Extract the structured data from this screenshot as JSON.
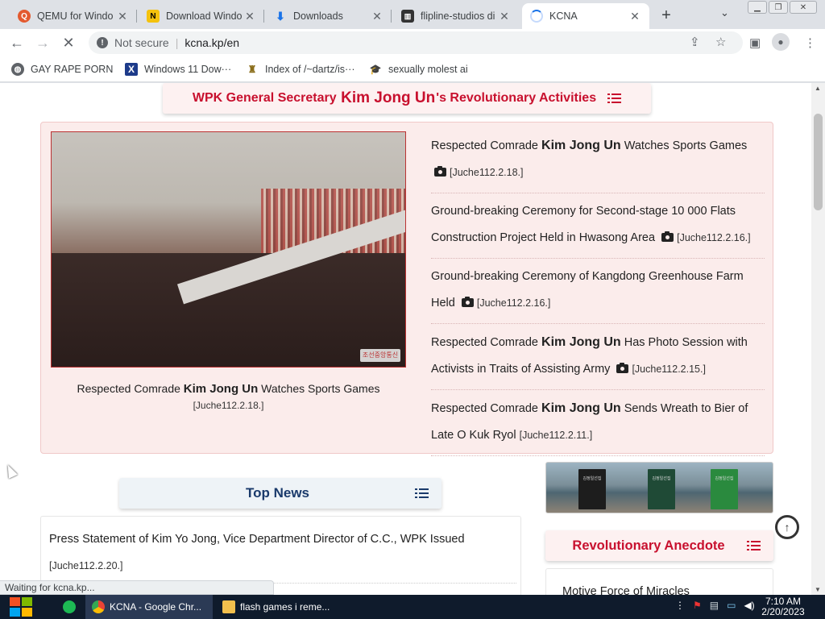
{
  "browser": {
    "tabs": [
      {
        "title": "QEMU for Windo",
        "icon": "qemu-icon",
        "active": false
      },
      {
        "title": "Download Windo",
        "icon": "download-site-icon",
        "active": false
      },
      {
        "title": "Downloads",
        "icon": "download-icon",
        "active": false
      },
      {
        "title": "flipline-studios di",
        "icon": "archive-icon",
        "active": false
      },
      {
        "title": "KCNA",
        "icon": "loading-icon",
        "active": true
      }
    ],
    "new_tab": "+",
    "address": {
      "security": "Not secure",
      "url": "kcna.kp/en"
    },
    "bookmarks": [
      {
        "label": "GAY RAPE PORN",
        "icon": "globe-icon"
      },
      {
        "label": "Windows 11 Dow···",
        "icon": "x-logo-icon"
      },
      {
        "label": "Index of /~dartz/is···",
        "icon": "folder-man-icon"
      },
      {
        "label": "sexually molest ai",
        "icon": "cap-icon"
      }
    ],
    "status": "Waiting for kcna.kp..."
  },
  "page": {
    "hero_title": {
      "prefix": "WPK General Secretary ",
      "name": "Kim Jong Un",
      "suffix": "'s Revolutionary Activities"
    },
    "hero_photo_watermark": "조선중앙통신",
    "hero_caption": {
      "prefix": "Respected Comrade ",
      "name": "Kim Jong Un",
      "suffix": " Watches Sports Games",
      "date": "[Juche112.2.18.]"
    },
    "news": [
      {
        "prefix": "Respected Comrade ",
        "name": "Kim Jong Un",
        "suffix": " Watches Sports Games",
        "photo": true,
        "date": "[Juche112.2.18.]"
      },
      {
        "prefix": "Ground-breaking Ceremony for Second-stage 10 000 Flats Construction Project Held in Hwasong Area",
        "name": "",
        "suffix": "",
        "photo": true,
        "date": "[Juche112.2.16.]"
      },
      {
        "prefix": "Ground-breaking Ceremony of Kangdong Greenhouse Farm Held",
        "name": "",
        "suffix": "",
        "photo": true,
        "date": "[Juche112.2.16.]"
      },
      {
        "prefix": "Respected Comrade ",
        "name": "Kim Jong Un",
        "suffix": " Has Photo Session with Activists in Traits of Assisting Army",
        "photo": true,
        "date": "[Juche112.2.15.]"
      },
      {
        "prefix": "Respected Comrade ",
        "name": "Kim Jong Un",
        "suffix": " Sends Wreath to Bier of Late O Kuk Ryol",
        "photo": false,
        "date": "[Juche112.2.11.]"
      }
    ],
    "top_news": {
      "title": "Top News",
      "items": [
        {
          "text": "Press Statement of Kim Yo Jong, Vice Department Director of C.C., WPK Issued",
          "date": "[Juche112.2.20.]"
        }
      ]
    },
    "books_banner": [
      "김정일선집",
      "김정일선집",
      "김정일선집"
    ],
    "anecdote": {
      "title": "Revolutionary Anecdote",
      "items": [
        "Motive Force of Miracles"
      ]
    }
  },
  "taskbar": {
    "apps": [
      {
        "label": "KCNA - Google Chr...",
        "active": true
      },
      {
        "label": "flash games i reme...",
        "active": false
      }
    ],
    "time": "7:10 AM",
    "date": "2/20/2023"
  },
  "colors": {
    "accent_red": "#c8102e",
    "top_news_blue": "#1a3a6b",
    "hero_bg": "#fbeceb",
    "taskbar": "#0f1b2c"
  }
}
